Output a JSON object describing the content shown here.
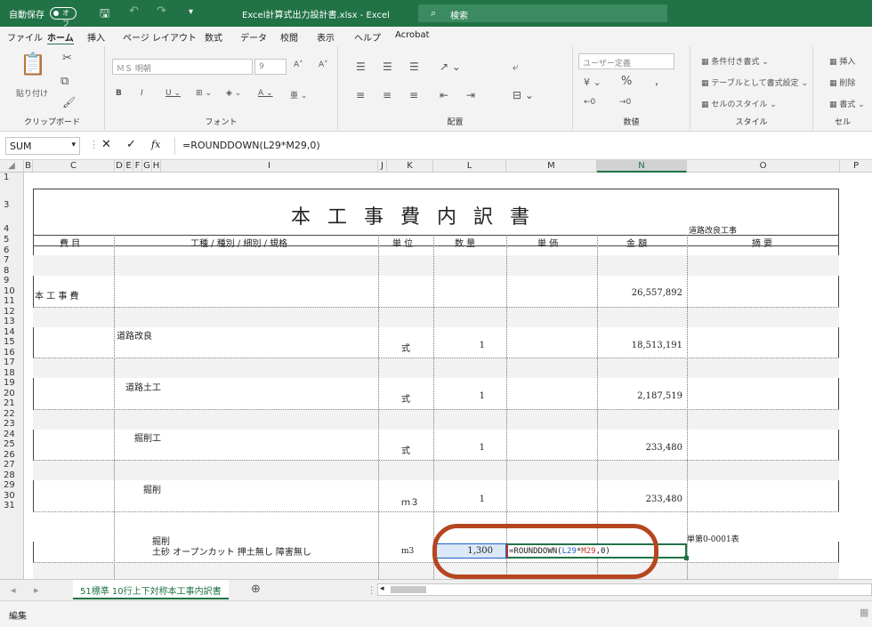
{
  "titlebar": {
    "autosave_label": "自動保存",
    "autosave_state": "オフ",
    "title": "Excel計算式出力設計書.xlsx - Excel",
    "search_placeholder": "検索"
  },
  "menu": [
    "ファイル",
    "ホーム",
    "挿入",
    "ページ レイアウト",
    "数式",
    "データ",
    "校閲",
    "表示",
    "ヘルプ",
    "Acrobat"
  ],
  "ribbon": {
    "paste_label": "貼り付け",
    "clipboard_label": "クリップボード",
    "font_name": "ＭＳ 明朝",
    "font_size": "9",
    "font_label": "フォント",
    "alignment_label": "配置",
    "number_format": "ユーザー定義",
    "number_label": "数値",
    "style_conditional": "条件付き書式",
    "style_table": "テーブルとして書式設定",
    "style_cell": "セルのスタイル",
    "style_label": "スタイル",
    "cells_insert": "挿入",
    "cells_delete": "削除",
    "cells_format": "書式",
    "cells_label": "セル"
  },
  "formula_bar": {
    "name_box": "SUM",
    "fx": "fx",
    "formula": "=ROUNDDOWN(L29*M29,0)"
  },
  "columns": [
    "B",
    "C",
    "D",
    "E",
    "F",
    "G",
    "H",
    "I",
    "J",
    "K",
    "L",
    "M",
    "N",
    "O",
    "P"
  ],
  "rows": [
    "1",
    "3",
    "4",
    "5",
    "6",
    "7",
    "8",
    "9",
    "10",
    "11",
    "12",
    "13",
    "14",
    "15",
    "16",
    "17",
    "18",
    "19",
    "20",
    "21",
    "22",
    "23",
    "24",
    "25",
    "26",
    "27",
    "28",
    "29",
    "30",
    "31"
  ],
  "document": {
    "title": "本 工 事 費 内 訳 書",
    "subtitle": "道路改良工事",
    "headers": {
      "himoku": "費 目",
      "koshu": "工種 / 種別 / 細別 / 規格",
      "tani": "単 位",
      "suryo": "数 量",
      "tanka": "単 価",
      "kingaku": "金 額",
      "tekiyo": "摘 要"
    },
    "items": [
      {
        "himoku": "本 工 事 費",
        "name": "",
        "unit": "",
        "qty": "",
        "amount": "26,557,892"
      },
      {
        "himoku": "",
        "name": "道路改良",
        "unit": "式",
        "qty": "1",
        "amount": "18,513,191"
      },
      {
        "himoku": "",
        "name": "道路土工",
        "unit": "式",
        "qty": "1",
        "amount": "2,187,519"
      },
      {
        "himoku": "",
        "name": "掘削工",
        "unit": "式",
        "qty": "1",
        "amount": "233,480"
      },
      {
        "himoku": "",
        "name": "掘削",
        "unit": "ｍ３",
        "qty": "1",
        "amount": "233,480"
      }
    ],
    "edit_row": {
      "name1": "掘削",
      "name2": "土砂 オープンカット 押土無し 障害無し",
      "unit": "m3",
      "qty": "1,300",
      "formula_prefix": "=ROUNDDOWN(",
      "ref1": "L29",
      "op": "*",
      "ref2": "M29",
      "formula_suffix": ",0)",
      "tekiyo": "単第0-0001表"
    }
  },
  "sheet_tab": "51標準 10行上下対称本工事内訳書",
  "status": "編集",
  "colors": {
    "excel_green": "#217346",
    "highlight_circle": "#b5461f",
    "ref_blue": "#1f5fc8",
    "ref_red": "#c0352b"
  }
}
